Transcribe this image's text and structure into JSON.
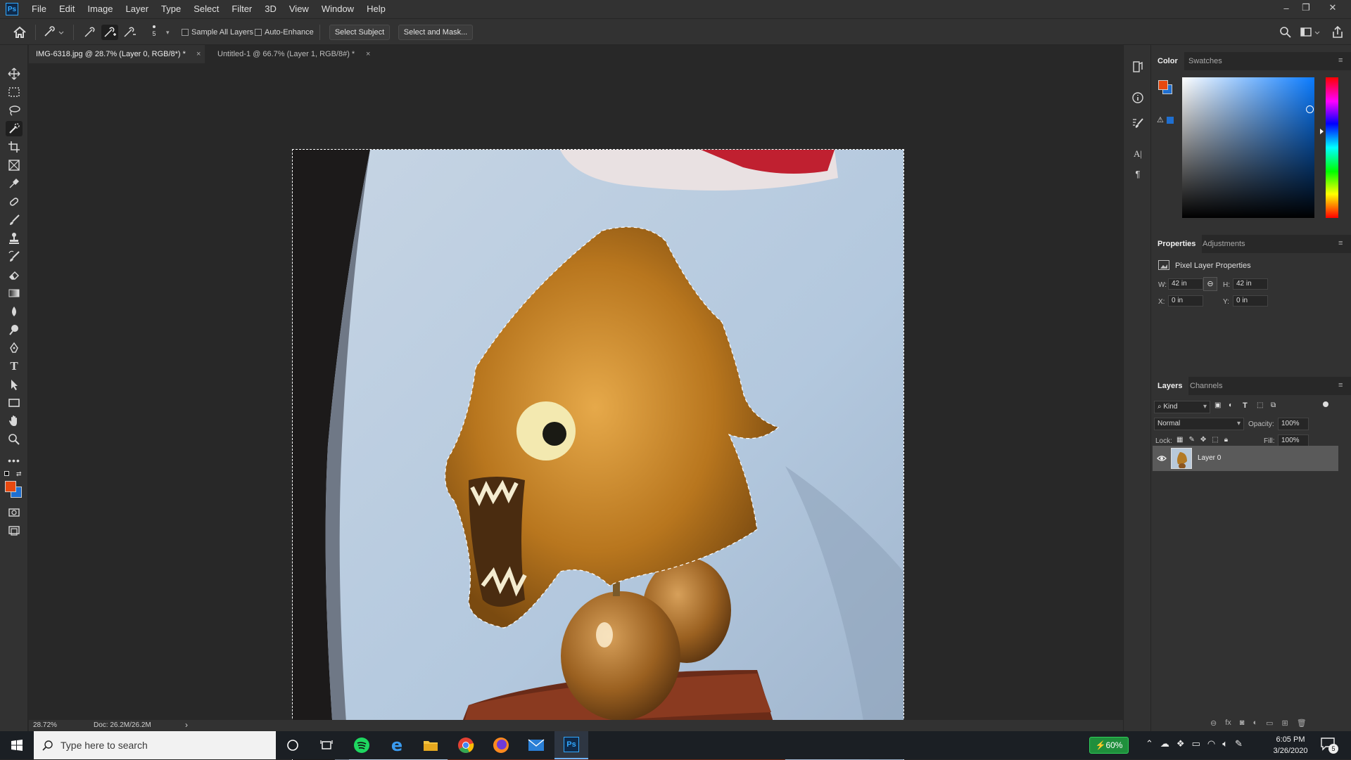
{
  "app": {
    "logo_text": "Ps"
  },
  "menu": [
    "File",
    "Edit",
    "Image",
    "Layer",
    "Type",
    "Select",
    "Filter",
    "3D",
    "View",
    "Window",
    "Help"
  ],
  "window_controls": {
    "minimize": "–",
    "restore": "❐",
    "close": "✕"
  },
  "options_bar": {
    "brush_size": "5",
    "sample_all_layers": "Sample All Layers",
    "auto_enhance": "Auto-Enhance",
    "select_subject": "Select Subject",
    "select_and_mask": "Select and Mask..."
  },
  "tabs": [
    {
      "label": "IMG-6318.jpg @ 28.7% (Layer 0, RGB/8*) *",
      "active": true
    },
    {
      "label": "Untitled-1 @ 66.7% (Layer 1, RGB/8#) *",
      "active": false
    }
  ],
  "tab_close_glyph": "×",
  "status_bar": {
    "zoom": "28.72%",
    "doc": "Doc: 26.2M/26.2M",
    "arrow": "›"
  },
  "colors": {
    "foreground": "#e8490f",
    "background": "#1f6fd0",
    "ui_bg": "#323232",
    "canvas_bg": "#282828"
  },
  "color_panel": {
    "tabs": [
      "Color",
      "Swatches"
    ],
    "warning_glyph": "⚠"
  },
  "properties_panel": {
    "tabs": [
      "Properties",
      "Adjustments"
    ],
    "header": "Pixel Layer Properties",
    "w_label": "W:",
    "w_value": "42 in",
    "h_label": "H:",
    "h_value": "42 in",
    "x_label": "X:",
    "x_value": "0 in",
    "y_label": "Y:",
    "y_value": "0 in"
  },
  "layers_panel": {
    "tabs": [
      "Layers",
      "Channels"
    ],
    "kind_filter": "Kind",
    "blend_mode": "Normal",
    "opacity_label": "Opacity:",
    "opacity_value": "100%",
    "lock_label": "Lock:",
    "fill_label": "Fill:",
    "fill_value": "100%",
    "layers": [
      {
        "name": "Layer 0",
        "visible": true
      }
    ]
  },
  "taskbar": {
    "search_placeholder": "Type here to search",
    "battery": "60%",
    "time": "6:05 PM",
    "date": "3/26/2020",
    "notifications": "5"
  },
  "icons": [
    "home-icon",
    "brush-preset-icon",
    "new-selection-icon",
    "add-selection-icon",
    "subtract-selection-icon",
    "search-icon",
    "workspace-icon",
    "share-icon",
    "move-tool-icon",
    "marquee-tool-icon",
    "lasso-tool-icon",
    "quick-selection-tool-icon",
    "crop-tool-icon",
    "frame-tool-icon",
    "eyedropper-tool-icon",
    "healing-brush-tool-icon",
    "brush-tool-icon",
    "clone-stamp-tool-icon",
    "history-brush-tool-icon",
    "eraser-tool-icon",
    "gradient-tool-icon",
    "blur-tool-icon",
    "dodge-tool-icon",
    "pen-tool-icon",
    "type-tool-icon",
    "path-selection-tool-icon",
    "rectangle-tool-icon",
    "hand-tool-icon",
    "zoom-tool-icon",
    "more-tools-icon",
    "quick-mask-icon",
    "screen-mode-icon",
    "eye-icon",
    "windows-start-icon",
    "cortana-icon",
    "task-view-icon",
    "spotify-icon",
    "edge-icon",
    "file-explorer-icon",
    "chrome-icon",
    "firefox-icon",
    "mail-icon",
    "photoshop-icon"
  ]
}
